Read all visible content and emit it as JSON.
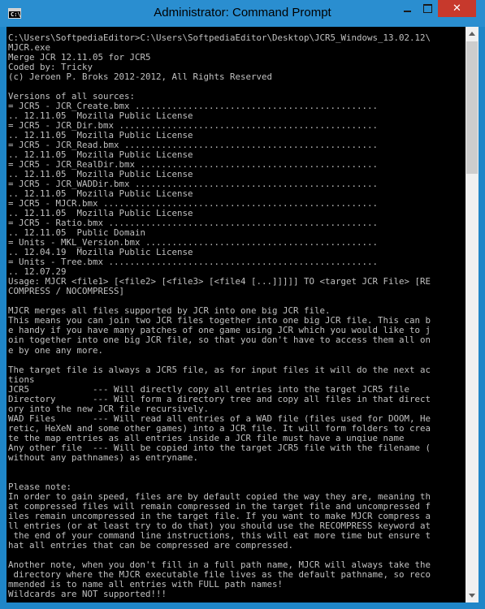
{
  "window": {
    "title": "Administrator: Command Prompt",
    "icon_label": "C:\\",
    "buttons": {
      "minimize": "minimize-icon",
      "maximize": "maximize-icon",
      "close": "close-icon",
      "close_glyph": "✕"
    }
  },
  "colors": {
    "titlebar": "#2a8ed0",
    "close": "#c7392c",
    "console_bg": "#000000",
    "console_text": "#c0c0c0"
  },
  "console": {
    "output": "C:\\Users\\SoftpediaEditor>C:\\Users\\SoftpediaEditor\\Desktop\\JCR5_Windows_13.02.12\\\nMJCR.exe\nMerge JCR 12.11.05 for JCR5\nCoded by: Tricky\n(c) Jeroen P. Broks 2012-2012, All Rights Reserved\n\nVersions of all sources:\n= JCR5 - JCR_Create.bmx ..............................................\n.. 12.11.05  Mozilla Public License\n= JCR5 - JCR_Dir.bmx .................................................\n.. 12.11.05  Mozilla Public License\n= JCR5 - JCR_Read.bmx ................................................\n.. 12.11.05  Mozilla Public License\n= JCR5 - JCR_RealDir.bmx .............................................\n.. 12.11.05  Mozilla Public License\n= JCR5 - JCR_WADDir.bmx ..............................................\n.. 12.11.05  Mozilla Public License\n= JCR5 - MJCR.bmx ....................................................\n.. 12.11.05  Mozilla Public License\n= JCR5 - Ratio.bmx ...................................................\n.. 12.11.05  Public Domain\n= Units - MKL_Version.bmx ............................................\n.. 12.04.19  Mozilla Public License\n= Units - Tree.bmx ...................................................\n.. 12.07.29\nUsage: MJCR <file1> [<file2> [<file3> [<file4 [...]]]]] TO <target JCR File> [RE\nCOMPRESS / NOCOMPRESS]\n\nMJCR merges all files supported by JCR into one big JCR file.\nThis means you can join two JCR files together into one big JCR file. This can b\ne handy if you have many patches of one game using JCR which you would like to j\noin together into one big JCR file, so that you don't have to access them all on\ne by one any more.\n\nThe target file is always a JCR5 file, as for input files it will do the next ac\ntions\nJCR5            --- Will directly copy all entries into the target JCR5 file\nDirectory       --- Will form a directory tree and copy all files in that direct\nory into the new JCR file recursively.\nWAD Files       --- Will read all entries of a WAD file (files used for DOOM, He\nretic, HeXeN and some other games) into a JCR file. It will form folders to crea\nte the map entries as all entries inside a JCR file must have a unqiue name\nAny other file  --- Will be copied into the target JCR5 file with the filename (\nwithout any pathnames) as entryname.\n\n\nPlease note:\nIn order to gain speed, files are by default copied the way they are, meaning th\nat compressed files will remain compressed in the target file and uncompressed f\niles remain uncompressed in the target file. If you want to make MJCR compress a\nll entries (or at least try to do that) you should use the RECOMPRESS keyword at\n the end of your command line instructions, this will eat more time but ensure t\nhat all entries that can be compressed are compressed.\n\nAnother note, when you don't fill in a full path name, MJCR will always take the\n directory where the MJCR executable file lives as the default pathname, so reco\nmmended is to name all entries with FULL path names!\nWildcards are NOT supported!!!"
  }
}
